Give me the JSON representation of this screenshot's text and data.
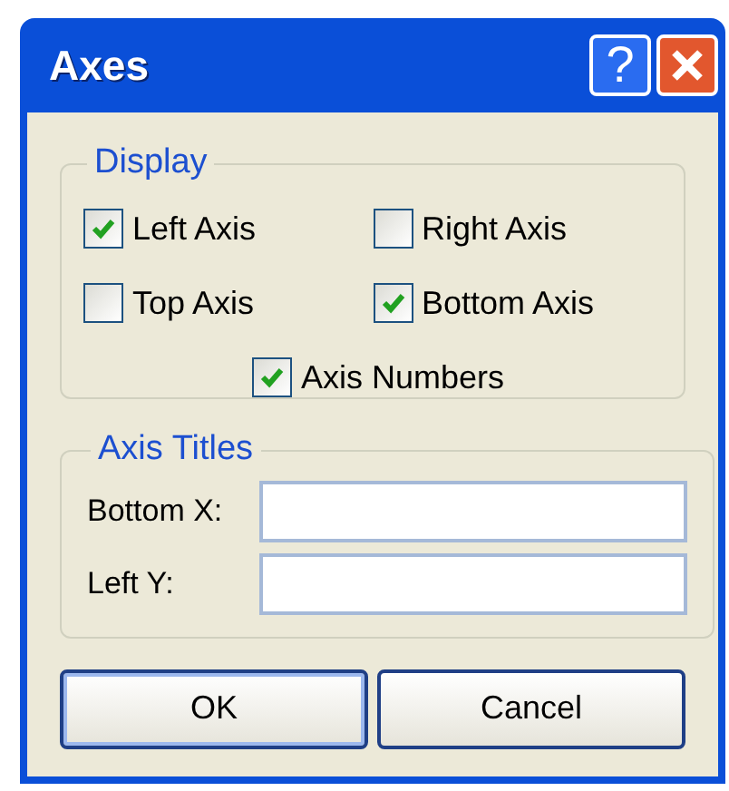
{
  "window": {
    "title": "Axes",
    "help_button": "?"
  },
  "display": {
    "title": "Display",
    "checkboxes": [
      {
        "label": "Left Axis",
        "checked": true
      },
      {
        "label": "Right Axis",
        "checked": false
      },
      {
        "label": "Top Axis",
        "checked": false
      },
      {
        "label": "Bottom Axis",
        "checked": true
      },
      {
        "label": "Axis Numbers",
        "checked": true
      }
    ]
  },
  "axis_titles": {
    "title": "Axis Titles",
    "fields": [
      {
        "label": "Bottom X:"
      },
      {
        "label": "Left Y:"
      }
    ]
  },
  "buttons": [
    "OK",
    "Cancel"
  ]
}
